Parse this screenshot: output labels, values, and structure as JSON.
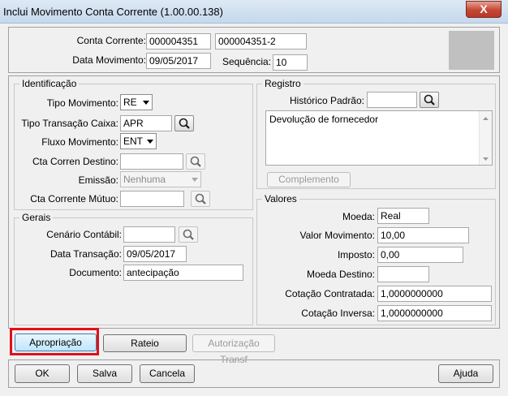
{
  "window": {
    "title": "Inclui Movimento Conta Corrente (1.00.00.138)",
    "close_label": "X"
  },
  "header": {
    "conta_corrente_label": "Conta Corrente:",
    "conta_corrente_value": "000004351",
    "conta_corrente_desc": "000004351-2",
    "data_movimento_label": "Data Movimento:",
    "data_movimento_value": "09/05/2017",
    "sequencia_label": "Sequência:",
    "sequencia_value": "10"
  },
  "identificacao": {
    "title": "Identificação",
    "tipo_movimento_label": "Tipo Movimento:",
    "tipo_movimento_value": "RE",
    "tipo_transacao_label": "Tipo Transação Caixa:",
    "tipo_transacao_value": "APR",
    "fluxo_movimento_label": "Fluxo Movimento:",
    "fluxo_movimento_value": "ENT",
    "cta_destino_label": "Cta Corren Destino:",
    "cta_destino_value": "",
    "emissao_label": "Emissão:",
    "emissao_value": "Nenhuma",
    "cta_mutuo_label": "Cta Corrente Mútuo:",
    "cta_mutuo_value": ""
  },
  "gerais": {
    "title": "Gerais",
    "cenario_label": "Cenário Contábil:",
    "cenario_value": "",
    "data_transacao_label": "Data Transação:",
    "data_transacao_value": "09/05/2017",
    "documento_label": "Documento:",
    "documento_value": "antecipação"
  },
  "registro": {
    "title": "Registro",
    "historico_label": "Histórico Padrão:",
    "historico_value": "",
    "text": "Devolução de fornecedor",
    "complemento_label": "Complemento"
  },
  "valores": {
    "title": "Valores",
    "moeda_label": "Moeda:",
    "moeda_value": "Real",
    "valor_label": "Valor Movimento:",
    "valor_value": "10,00",
    "imposto_label": "Imposto:",
    "imposto_value": "0,00",
    "moeda_destino_label": "Moeda Destino:",
    "moeda_destino_value": "",
    "cotacao_contratada_label": "Cotação Contratada:",
    "cotacao_contratada_value": "1,0000000000",
    "cotacao_inversa_label": "Cotação Inversa:",
    "cotacao_inversa_value": "1,0000000000"
  },
  "actions": {
    "apropriacao": "Apropriação",
    "rateio": "Rateio",
    "autorizacao": "Autorização Transf"
  },
  "footer": {
    "ok": "OK",
    "salva": "Salva",
    "cancela": "Cancela",
    "ajuda": "Ajuda"
  },
  "icons": {
    "search": "magnifier-icon",
    "dropdown": "triangle-down-icon",
    "close": "close-icon"
  },
  "colors": {
    "highlight": "#e0101a",
    "window_bg": "#f0f0f0",
    "close_button": "#c44834"
  }
}
